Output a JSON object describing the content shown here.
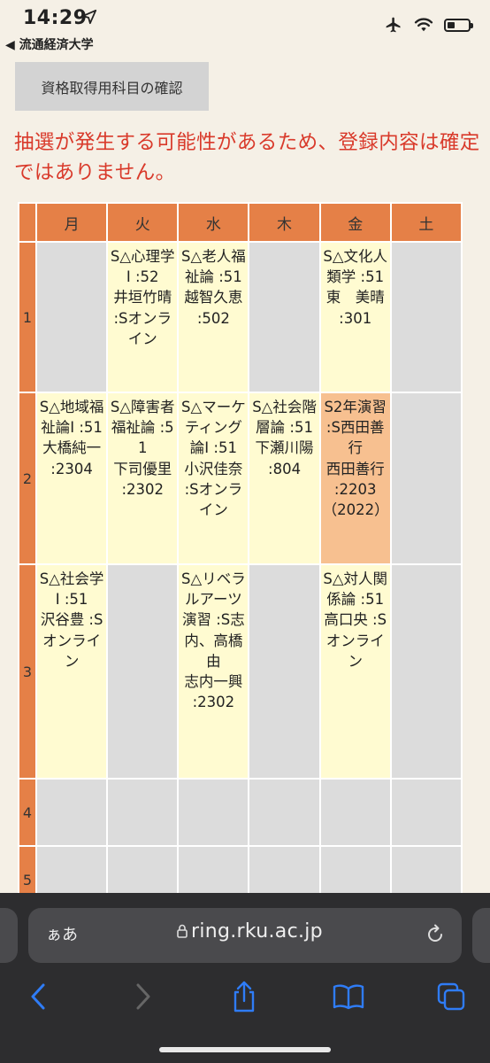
{
  "status": {
    "time": "14:29",
    "back_app": "◀ 流通経済大学"
  },
  "page": {
    "confirm_button": "資格取得用科目の確認",
    "warning": "抽選が発生する可能性があるため、登録内容は確定ではありません。"
  },
  "timetable": {
    "days": [
      "月",
      "火",
      "水",
      "木",
      "金",
      "土"
    ],
    "periods": [
      {
        "label": "1",
        "cells": [
          "",
          "S△心理学Ⅰ :52\n井垣竹晴 :Sオンライン",
          "S△老人福祉論 :51\n越智久恵 :502",
          "",
          "S△文化人類学 :51\n東　美晴 :301",
          ""
        ]
      },
      {
        "label": "2",
        "cells": [
          "S△地域福祉論Ⅰ :51\n大橋純一 :2304",
          "S△障害者福祉論 :51\n下司優里 :2302",
          "S△マーケティング論Ⅰ :51\n小沢佳奈 :Sオンライン",
          "S△社会階層論 :51\n下瀬川陽 :804",
          "S2年演習 :S西田善行\n西田善行 :2203（2022）",
          ""
        ]
      },
      {
        "label": "3",
        "cells": [
          "S△社会学Ⅰ :51\n沢谷豊 :Sオンライン",
          "",
          "S△リベラルアーツ演習 :S志内、高橋由\n志内一興 :2302",
          "",
          "S△対人関係論 :51\n高口央 :Sオンライン",
          ""
        ]
      },
      {
        "label": "4",
        "cells": [
          "",
          "",
          "",
          "",
          "",
          ""
        ]
      },
      {
        "label": "5",
        "cells": [
          "",
          "",
          "",
          "",
          "",
          ""
        ]
      }
    ]
  },
  "browser": {
    "aa_label": "ぁあ",
    "url": "ring.rku.ac.jp"
  },
  "colors": {
    "header_orange": "#e58047",
    "filled_cell": "#fffbd1",
    "highlight_cell": "#f7c090",
    "warning_red": "#d93a2b"
  }
}
